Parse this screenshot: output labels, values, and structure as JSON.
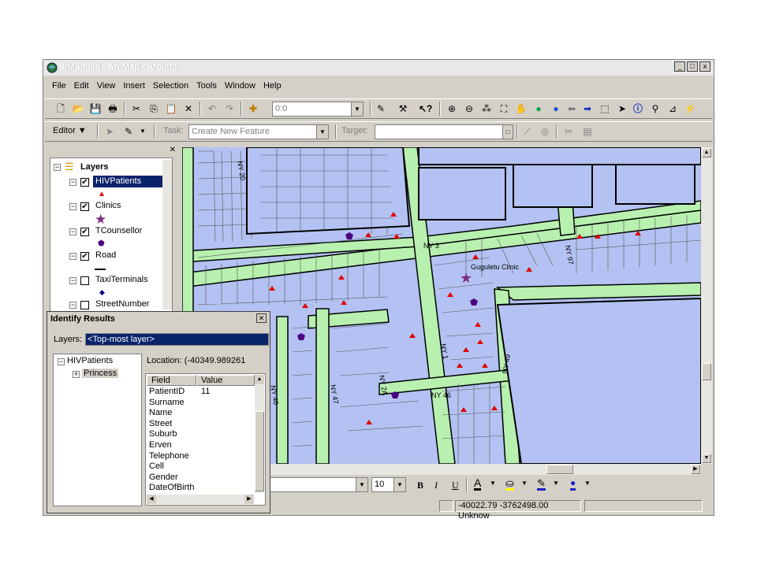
{
  "window": {
    "title": "SIMS.mxd - ArcMap - ArcInfo",
    "controls": [
      "_",
      "□",
      "x"
    ]
  },
  "menu": [
    "File",
    "Edit",
    "View",
    "Insert",
    "Selection",
    "Tools",
    "Window",
    "Help"
  ],
  "toolbar": {
    "scale_value": "0:0"
  },
  "editor": {
    "editor_label": "Editor",
    "task_label": "Task:",
    "task_value": "Create New Feature",
    "target_label": "Target:"
  },
  "toc": {
    "root_label": "Layers",
    "layers": [
      {
        "name": "HIVPatients",
        "checked": true,
        "selected": true,
        "symbol": "red-triangle"
      },
      {
        "name": "Clinics",
        "checked": true,
        "selected": false,
        "symbol": "purple-star"
      },
      {
        "name": "TCounsellor",
        "checked": true,
        "selected": false,
        "symbol": "purple-pentagon"
      },
      {
        "name": "Road",
        "checked": true,
        "selected": false,
        "symbol": "black-line"
      },
      {
        "name": "TaxiTerminals",
        "checked": false,
        "selected": false,
        "symbol": "navy-diamond"
      },
      {
        "name": "StreetNumber",
        "checked": false,
        "selected": false,
        "symbol": ""
      }
    ],
    "check_mark": "✔"
  },
  "map": {
    "clinic_label": "Guguletu Clinic",
    "road_labels": [
      "NY 3",
      "NY 1",
      "NY 46",
      "NY 49",
      "NY 97",
      "NY 20",
      "NY 47",
      "NY 2A",
      "NY 46"
    ],
    "colors": {
      "land": "#b3c2f2",
      "road_fill": "#b8f0b0",
      "outline": "#000000",
      "patient": "#e00000",
      "counsellor": "#4b0082",
      "clinic": "#7b2c82"
    }
  },
  "identify": {
    "title": "Identify Results",
    "layers_label": "Layers:",
    "layers_value": "<Top-most layer>",
    "tree_root": "HIVPatients",
    "tree_child": "Princess",
    "location_text": "Location: (-40349.989261",
    "col_field": "Field",
    "col_value": "Value",
    "fields": [
      "PatientID",
      "Surname",
      "Name",
      "Street",
      "Suburb",
      "Erven",
      "Telephone",
      "Cell",
      "Gender",
      "DateOfBirth"
    ],
    "values": [
      "11",
      "",
      "",
      "",
      "",
      "",
      "",
      "",
      "",
      ""
    ]
  },
  "format_toolbar": {
    "font_size": "10",
    "bold": "B",
    "italic": "I",
    "underline": "U",
    "font_color_letter": "A"
  },
  "status": {
    "coords": "-40022.79  -3762498.00 Unknow"
  }
}
